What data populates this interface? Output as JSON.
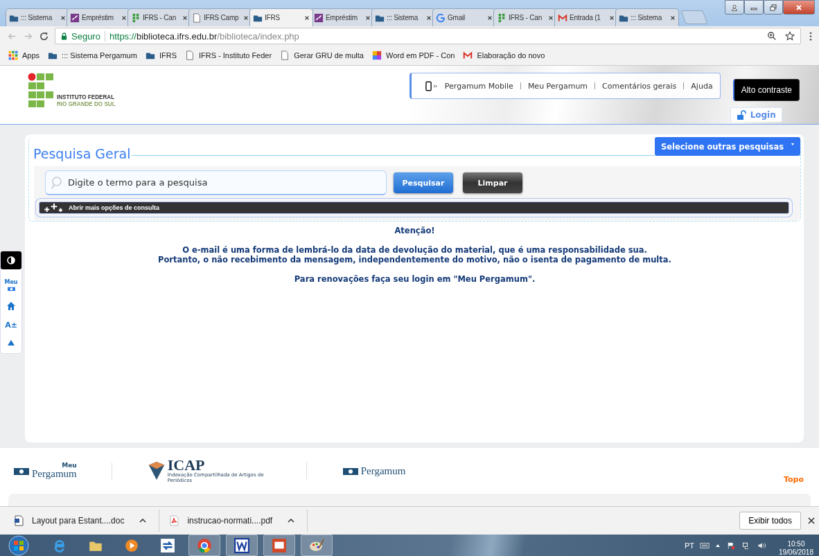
{
  "browser": {
    "tabs": [
      {
        "label": "::: Sistema",
        "kind": "pergamum",
        "selected": false
      },
      {
        "label": "Empréstim",
        "kind": "loan",
        "selected": false
      },
      {
        "label": "IFRS - Can",
        "kind": "ifrs",
        "selected": false
      },
      {
        "label": "IFRS Camp",
        "kind": "doc",
        "selected": false
      },
      {
        "label": "IFRS",
        "kind": "pergamum",
        "selected": true
      },
      {
        "label": "Empréstim",
        "kind": "loan",
        "selected": false
      },
      {
        "label": "::: Sistema",
        "kind": "pergamum",
        "selected": false
      },
      {
        "label": "Gmail",
        "kind": "google",
        "selected": false
      },
      {
        "label": "IFRS - Can",
        "kind": "ifrs",
        "selected": false
      },
      {
        "label": "Entrada (1",
        "kind": "gmail",
        "selected": false
      },
      {
        "label": "::: Sistema",
        "kind": "pergamum",
        "selected": false
      }
    ],
    "address": {
      "secure_label": "Seguro",
      "scheme": "https://",
      "host": "biblioteca.ifrs.edu.br",
      "path": "/biblioteca/index.php"
    },
    "bookmarks": [
      {
        "label": "Apps",
        "kind": "apps"
      },
      {
        "label": "::: Sistema Pergamum",
        "kind": "pergamum"
      },
      {
        "label": "IFRS",
        "kind": "pergamum"
      },
      {
        "label": "IFRS - Instituto Feder",
        "kind": "doc"
      },
      {
        "label": "Gerar GRU de multa",
        "kind": "doc"
      },
      {
        "label": "Word em PDF - Con",
        "kind": "colors"
      },
      {
        "label": "Elaboração do novo",
        "kind": "gmail"
      }
    ]
  },
  "header": {
    "logo_line_1": "INSTITUTO FEDERAL",
    "logo_line_2": "RIO GRANDE DO SUL",
    "links": [
      "Pergamum Mobile",
      "Meu Pergamum",
      "Comentários gerais",
      "Ajuda"
    ],
    "contrast_button": "Alto contraste",
    "login": "Login"
  },
  "side_tools": {
    "meu_label": "Meu",
    "font_label": "A±"
  },
  "search": {
    "legend": "Pesquisa Geral",
    "other_searches": "Selecione outras pesquisas",
    "placeholder": "Digite o termo para a pesquisa",
    "search_button": "Pesquisar",
    "clear_button": "Limpar",
    "more_options": "Abrir mais opções de consulta"
  },
  "notice": {
    "title": "Atenção!",
    "lines": [
      "O e-mail é uma forma de lembrá-lo da data de devolução do material, que é uma responsabilidade sua.",
      "Portanto, o não recebimento da mensagem, independentemente do motivo, não o isenta de pagamento de multa."
    ],
    "renewal": "Para renovações faça seu login em \"Meu Pergamum\"."
  },
  "footer": {
    "meu_small": "Meu",
    "meu_pergamum": "Pergamum",
    "icap": "ICAP",
    "icap_sub": "Indexação Compartilhada de Artigos de Periódicos",
    "pergamum": "Pergamum",
    "top_link": "Topo"
  },
  "downloads": {
    "items": [
      {
        "name": "Layout para Estant....doc",
        "kind": "word"
      },
      {
        "name": "instrucao-normati....pdf",
        "kind": "pdf"
      }
    ],
    "show_all": "Exibir todos"
  },
  "taskbar": {
    "language": "PT",
    "time": "10:50",
    "date": "19/06/2018"
  }
}
